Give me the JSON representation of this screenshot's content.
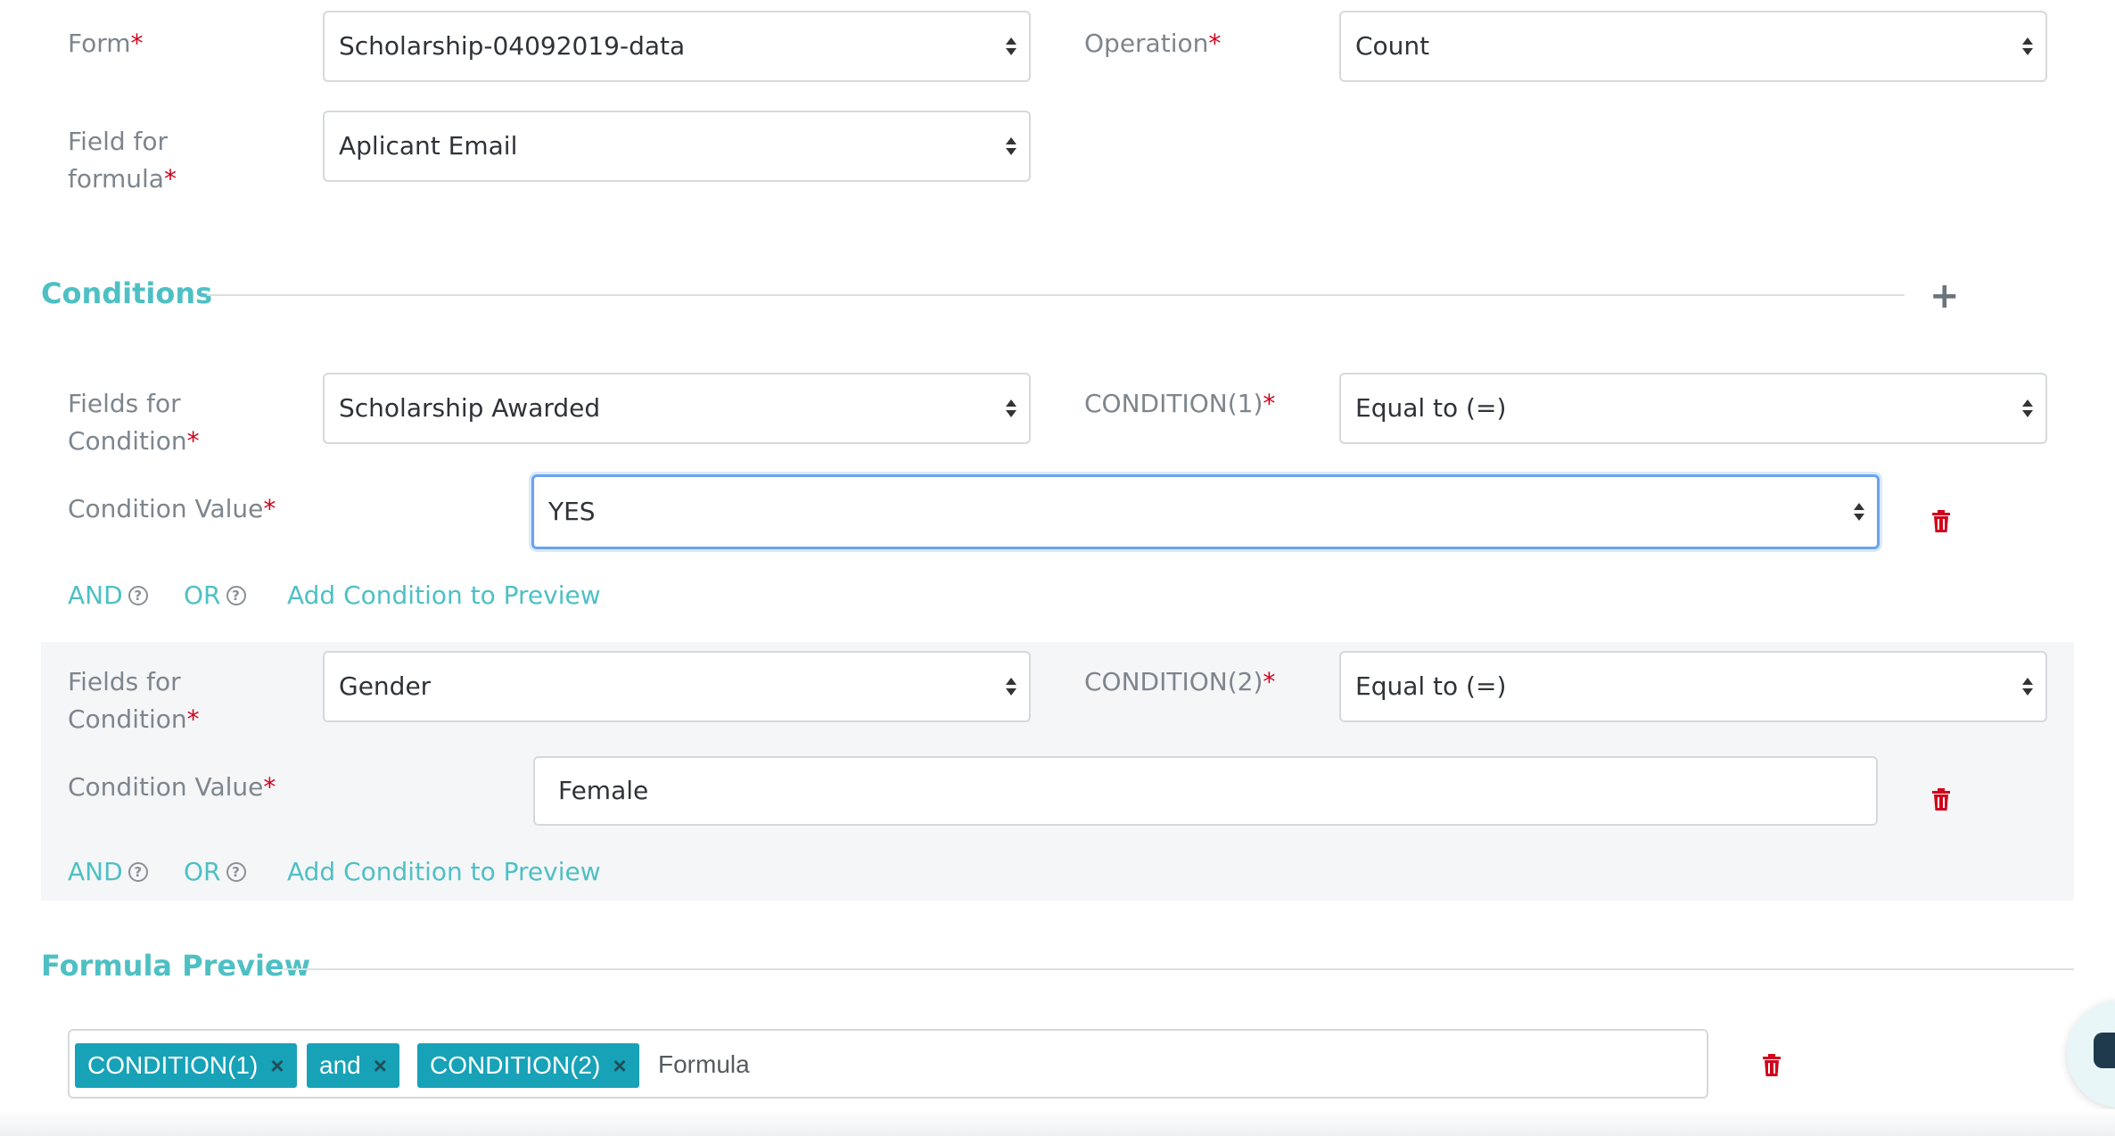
{
  "form": {
    "form_label": "Form",
    "form_value": "Scholarship-04092019-data",
    "operation_label": "Operation",
    "operation_value": "Count",
    "field_label_line1": "Field for",
    "field_label_line2": "formula",
    "field_value": "Aplicant Email",
    "required_mark": "*"
  },
  "conditions": {
    "title": "Conditions",
    "add_icon": "plus-icon",
    "items": [
      {
        "fields_label_line1": "Fields for",
        "fields_label_line2": "Condition",
        "field_value": "Scholarship Awarded",
        "condition_label": "CONDITION(1)",
        "condition_value": "Equal to (=)",
        "value_label": "Condition Value",
        "value": "YES",
        "and_label": "AND",
        "or_label": "OR",
        "add_preview_label": "Add Condition to Preview"
      },
      {
        "fields_label_line1": "Fields for",
        "fields_label_line2": "Condition",
        "field_value": "Gender",
        "condition_label": "CONDITION(2)",
        "condition_value": "Equal to (=)",
        "value_label": "Condition Value",
        "value": "Female",
        "and_label": "AND",
        "or_label": "OR",
        "add_preview_label": "Add Condition to Preview"
      }
    ]
  },
  "formula_preview": {
    "title": "Formula Preview",
    "tags": [
      "CONDITION(1)",
      "and",
      "CONDITION(2)"
    ],
    "remove_glyph": "×",
    "placeholder": "Formula"
  },
  "colors": {
    "accent": "#4ec0c4",
    "tag_bg": "#17a2b8",
    "required": "#d0021b",
    "delete": "#d0021b"
  }
}
